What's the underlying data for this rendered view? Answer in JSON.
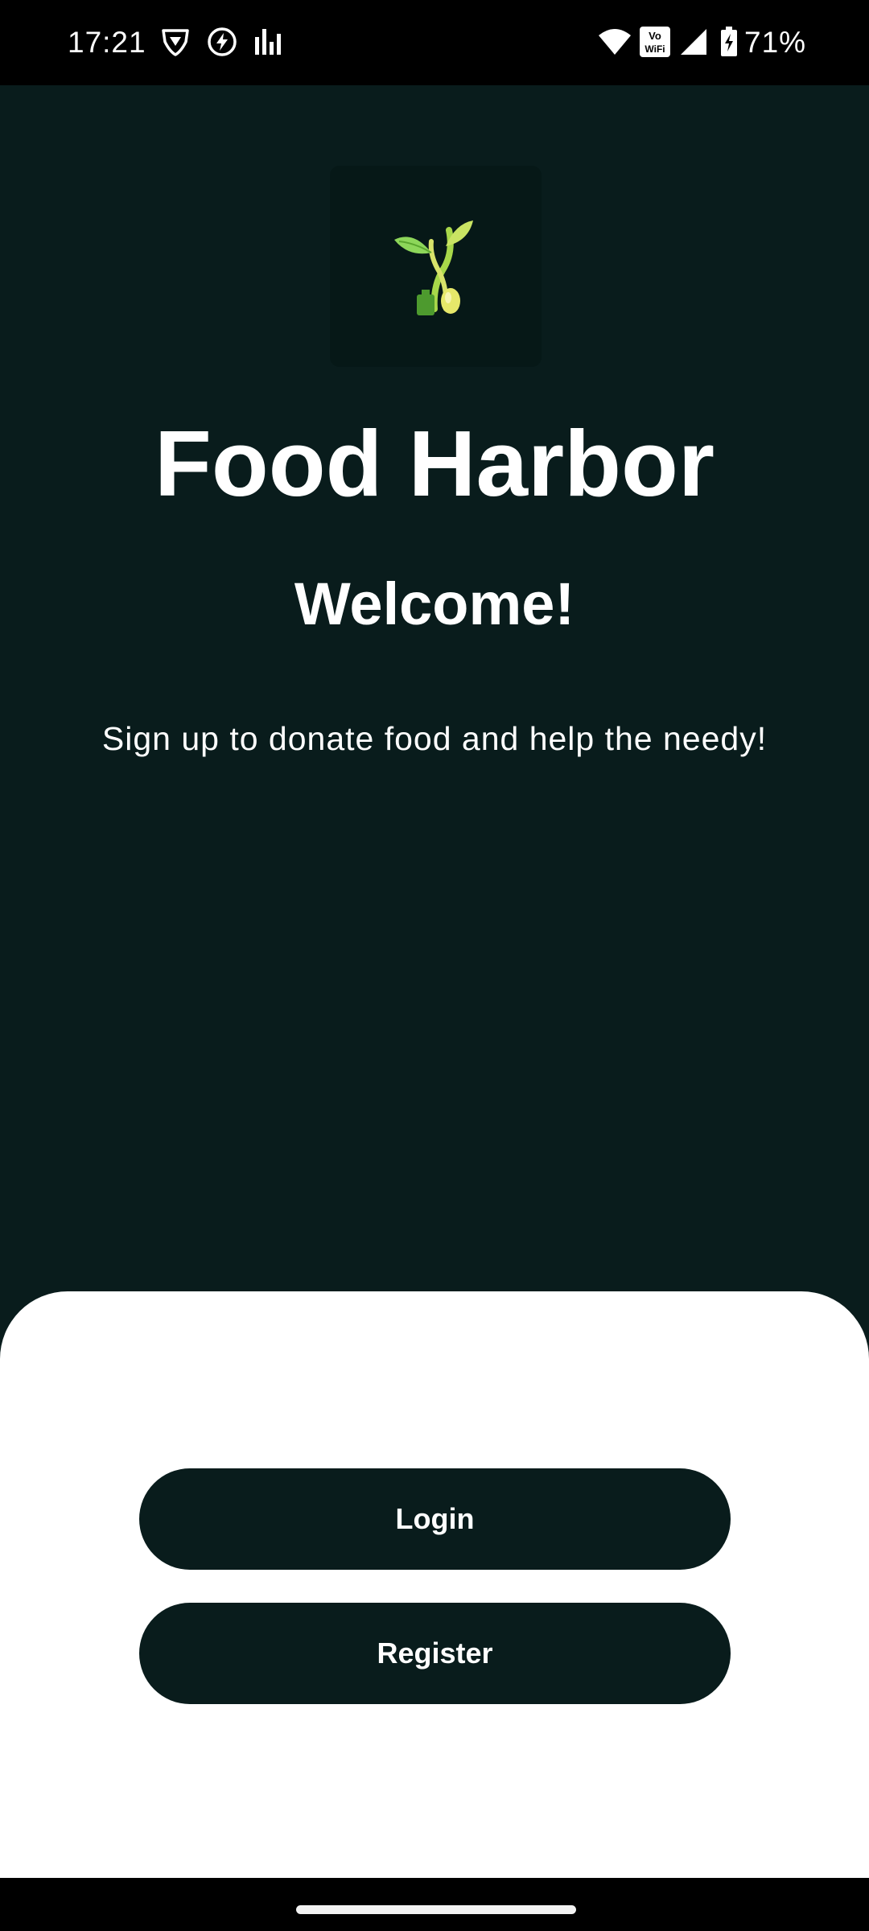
{
  "status_bar": {
    "time": "17:21",
    "battery_percent": "71%",
    "vowifi_badge_top": "Vo",
    "vowifi_badge_bottom": "WiFi",
    "icons": [
      "vpn-shield-icon",
      "power-saving-icon",
      "signal-bars-app-icon",
      "wifi-icon",
      "vowifi-icon",
      "cell-signal-icon",
      "battery-charging-icon"
    ]
  },
  "app": {
    "logo_icon": "sprout-spoon-logo-icon",
    "title": "Food Harbor",
    "welcome": "Welcome!",
    "tagline": "Sign up to donate food and help the needy!"
  },
  "actions": {
    "login_label": "Login",
    "register_label": "Register"
  },
  "colors": {
    "background": "#091c1c",
    "logo_tile": "#061817",
    "button": "#091c1c",
    "sheet": "#ffffff",
    "leaf_green": "#8dd65a",
    "leaf_yellow": "#e6e86a"
  }
}
